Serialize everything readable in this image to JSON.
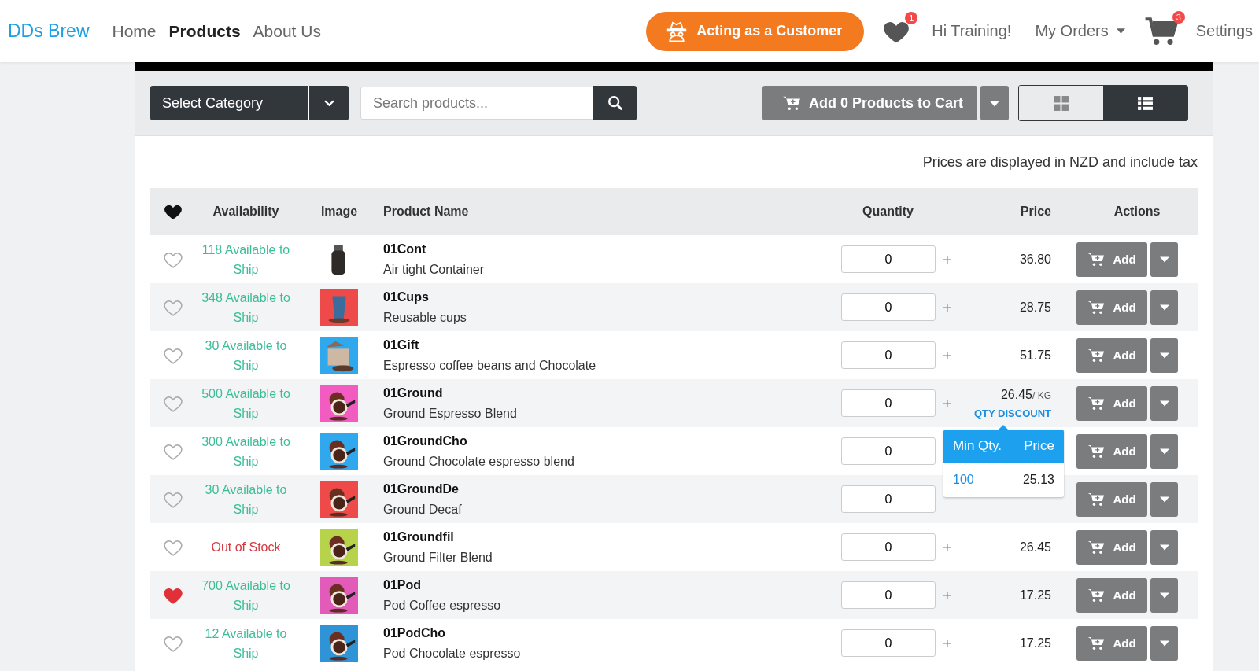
{
  "nav": {
    "brand": "DDs Brew",
    "links": [
      {
        "label": "Home",
        "selected": false
      },
      {
        "label": "Products",
        "selected": true
      },
      {
        "label": "About Us",
        "selected": false
      }
    ],
    "acting_button": "Acting as a Customer",
    "wishlist_badge": "1",
    "greeting": "Hi Training!",
    "orders_menu": "My Orders",
    "cart_badge": "3",
    "settings": "Settings"
  },
  "toolbar": {
    "category": "Select Category",
    "search": {
      "placeholder": "Search products..."
    },
    "add_to_cart": "Add 0 Products to Cart",
    "views": [
      {
        "kind": "grid",
        "selected": false
      },
      {
        "kind": "list",
        "selected": true
      }
    ]
  },
  "note": "Prices are displayed in NZD and include tax",
  "table": {
    "columns": [
      "Availability",
      "Image",
      "Product Name",
      "Quantity",
      "Price",
      "Actions"
    ],
    "rows": [
      {
        "favorite": false,
        "in_stock": true,
        "availability": "118 Available to Ship",
        "code": "01Cont",
        "name": "Air tight Container",
        "quantity": "0",
        "price": "36.80",
        "action": "Add"
      },
      {
        "favorite": false,
        "in_stock": true,
        "availability": "348 Available to Ship",
        "code": "01Cups",
        "name": "Reusable cups",
        "quantity": "0",
        "price": "28.75",
        "action": "Add"
      },
      {
        "favorite": false,
        "in_stock": true,
        "availability": "30 Available to Ship",
        "code": "01Gift",
        "name": "Espresso coffee beans and Chocolate",
        "quantity": "0",
        "price": "51.75",
        "action": "Add"
      },
      {
        "favorite": false,
        "in_stock": true,
        "availability": "500 Available to Ship",
        "code": "01Ground",
        "name": "Ground Espresso Blend",
        "quantity": "0",
        "price": "26.45",
        "unit": "/ KG",
        "discount_link": "QTY DISCOUNT",
        "action": "Add",
        "discount_popover": {
          "columns": [
            "Min Qty.",
            "Price"
          ],
          "rows": [
            [
              "100",
              "25.13"
            ]
          ]
        }
      },
      {
        "favorite": false,
        "in_stock": true,
        "availability": "300 Available to Ship",
        "code": "01GroundCho",
        "name": "Ground Chocolate espresso blend",
        "quantity": "0",
        "plus_hidden": true,
        "action": "Add"
      },
      {
        "favorite": false,
        "in_stock": true,
        "availability": "30 Available to Ship",
        "code": "01GroundDe",
        "name": "Ground Decaf",
        "quantity": "0",
        "plus_hidden": true,
        "action": "Add"
      },
      {
        "favorite": false,
        "in_stock": false,
        "availability": "Out of Stock",
        "code": "01Groundfil",
        "name": "Ground Filter Blend",
        "quantity": "0",
        "price": "26.45",
        "action": "Add"
      },
      {
        "favorite": true,
        "in_stock": true,
        "availability": "700 Available to Ship",
        "code": "01Pod",
        "name": "Pod Coffee espresso",
        "quantity": "0",
        "price": "17.25",
        "action": "Add"
      },
      {
        "favorite": false,
        "in_stock": true,
        "availability": "12 Available to Ship",
        "code": "01PodCho",
        "name": "Pod Chocolate espresso",
        "quantity": "0",
        "price": "17.25",
        "action": "Add"
      }
    ]
  }
}
